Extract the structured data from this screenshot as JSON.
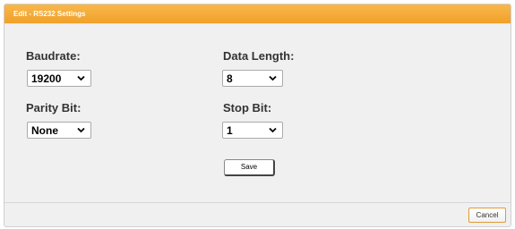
{
  "dialog": {
    "title": "Edit - RS232 Settings",
    "accent_color": "#f0a02a"
  },
  "form": {
    "baudrate": {
      "label": "Baudrate:",
      "value": "19200"
    },
    "data_length": {
      "label": "Data Length:",
      "value": "8"
    },
    "parity_bit": {
      "label": "Parity Bit:",
      "value": "None"
    },
    "stop_bit": {
      "label": "Stop Bit:",
      "value": "1"
    },
    "save_label": "Save"
  },
  "footer": {
    "cancel_label": "Cancel"
  },
  "icons": {
    "dropdown": "chevron-down-icon"
  }
}
